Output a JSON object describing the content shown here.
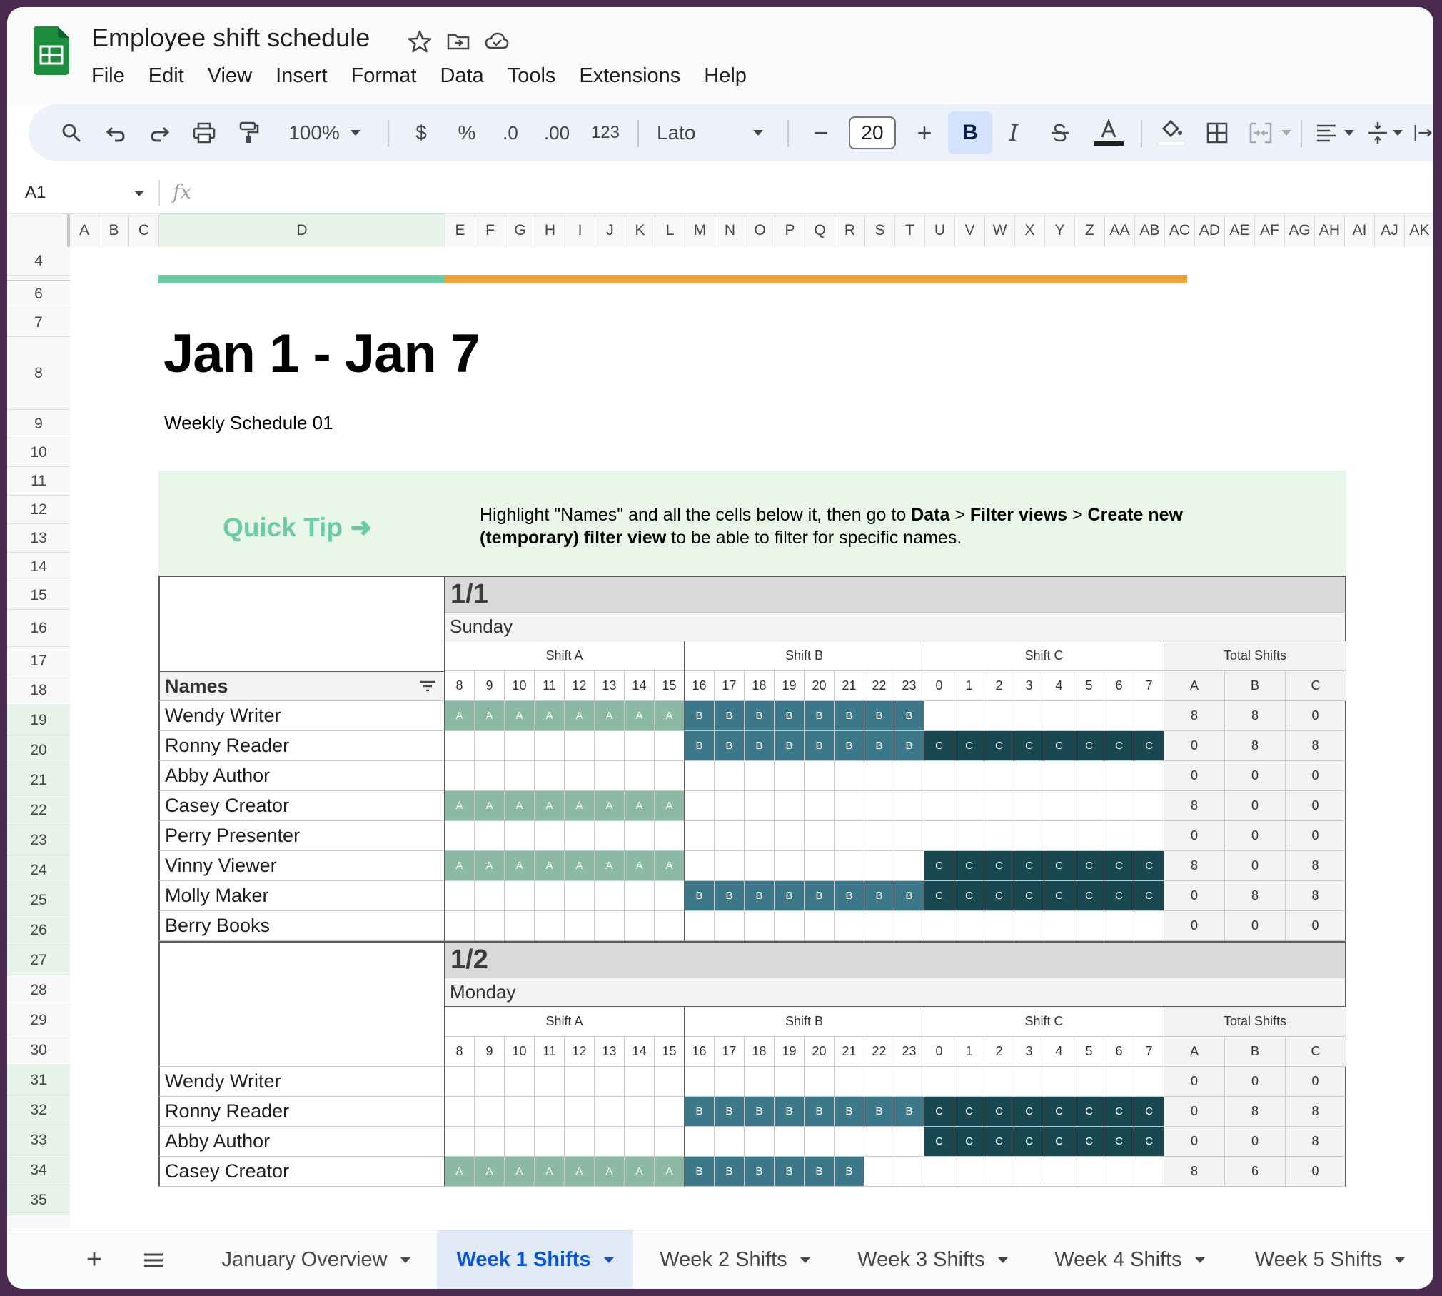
{
  "header": {
    "doc_title": "Employee shift schedule",
    "menu": [
      "File",
      "Edit",
      "View",
      "Insert",
      "Format",
      "Data",
      "Tools",
      "Extensions",
      "Help"
    ]
  },
  "toolbar": {
    "zoom": "100%",
    "currency": "$",
    "percent": "%",
    "dec_decrease": ".0",
    "dec_increase": ".00",
    "number_format": "123",
    "font": "Lato",
    "font_size": "20",
    "bold": "B",
    "italic": "I"
  },
  "formula_bar": {
    "cell_ref": "A1",
    "fx": "fx"
  },
  "columns": [
    "A",
    "B",
    "C",
    "D",
    "E",
    "F",
    "G",
    "H",
    "I",
    "J",
    "K",
    "L",
    "M",
    "N",
    "O",
    "P",
    "Q",
    "R",
    "S",
    "T",
    "U",
    "V",
    "W",
    "X",
    "Y",
    "Z",
    "AA",
    "AB",
    "AC",
    "AD",
    "AE",
    "AF",
    "AG",
    "AH",
    "AI",
    "AJ",
    "AK"
  ],
  "rows": [
    "4",
    "6",
    "7",
    "8",
    "9",
    "10",
    "11",
    "12",
    "13",
    "14",
    "15",
    "16",
    "17",
    "18",
    "19",
    "20",
    "21",
    "22",
    "23",
    "24",
    "25",
    "26",
    "27",
    "28",
    "29",
    "30",
    "31",
    "32",
    "33",
    "34",
    "35"
  ],
  "sheet": {
    "title": "Jan 1 - Jan 7",
    "subtitle": "Weekly Schedule 01",
    "tip_label": "Quick Tip ➜",
    "tip_parts": [
      {
        "t": "Highlight \"Names\" and all the cells below it, then go to ",
        "b": false
      },
      {
        "t": "Data",
        "b": true
      },
      {
        "t": " > ",
        "b": false
      },
      {
        "t": "Filter views",
        "b": true
      },
      {
        "t": " > ",
        "b": false
      },
      {
        "t": "Create new (temporary) filter view",
        "b": true
      },
      {
        "t": " to be able to filter for specific names.",
        "b": false
      }
    ],
    "names_header": "Names",
    "shift_labels": [
      "Shift A",
      "Shift B",
      "Shift C",
      "Total Shifts"
    ],
    "hours": [
      "8",
      "9",
      "10",
      "11",
      "12",
      "13",
      "14",
      "15",
      "16",
      "17",
      "18",
      "19",
      "20",
      "21",
      "22",
      "23",
      "0",
      "1",
      "2",
      "3",
      "4",
      "5",
      "6",
      "7"
    ],
    "total_cols": [
      "A",
      "B",
      "C"
    ],
    "days": [
      {
        "date": "1/1",
        "weekday": "Sunday",
        "show_names_header": true,
        "people": [
          {
            "name": "Wendy Writer",
            "a": 8,
            "b": 8,
            "c": 0,
            "ta": "8",
            "tb": "8",
            "tc": "0"
          },
          {
            "name": "Ronny Reader",
            "a": 0,
            "b": 8,
            "c": 8,
            "ta": "0",
            "tb": "8",
            "tc": "8"
          },
          {
            "name": "Abby Author",
            "a": 0,
            "b": 0,
            "c": 0,
            "ta": "0",
            "tb": "0",
            "tc": "0"
          },
          {
            "name": "Casey Creator",
            "a": 8,
            "b": 0,
            "c": 0,
            "ta": "8",
            "tb": "0",
            "tc": "0"
          },
          {
            "name": "Perry Presenter",
            "a": 0,
            "b": 0,
            "c": 0,
            "ta": "0",
            "tb": "0",
            "tc": "0"
          },
          {
            "name": "Vinny Viewer",
            "a": 8,
            "b": 0,
            "c": 8,
            "ta": "8",
            "tb": "0",
            "tc": "8"
          },
          {
            "name": "Molly Maker",
            "a": 0,
            "b": 8,
            "c": 8,
            "ta": "0",
            "tb": "8",
            "tc": "8"
          },
          {
            "name": "Berry Books",
            "a": 0,
            "b": 0,
            "c": 0,
            "ta": "0",
            "tb": "0",
            "tc": "0"
          }
        ]
      },
      {
        "date": "1/2",
        "weekday": "Monday",
        "show_names_header": false,
        "people": [
          {
            "name": "Wendy Writer",
            "a": 0,
            "b": 0,
            "c": 0,
            "ta": "0",
            "tb": "0",
            "tc": "0"
          },
          {
            "name": "Ronny Reader",
            "a": 0,
            "b": 8,
            "c": 8,
            "ta": "0",
            "tb": "8",
            "tc": "8"
          },
          {
            "name": "Abby Author",
            "a": 0,
            "b": 0,
            "c": 8,
            "ta": "0",
            "tb": "0",
            "tc": "8"
          },
          {
            "name": "Casey Creator",
            "a": 8,
            "b": 6,
            "c": 0,
            "ta": "8",
            "tb": "6",
            "tc": "0"
          }
        ]
      }
    ]
  },
  "tabs": [
    "January Overview",
    "Week 1 Shifts",
    "Week 2 Shifts",
    "Week 3 Shifts",
    "Week 4 Shifts",
    "Week 5 Shifts"
  ],
  "active_tab": 1,
  "colors": {
    "shiftA": "#8cb8a6",
    "shiftB": "#3c7889",
    "shiftC": "#1a4850",
    "accent_green": "#6fcaa8",
    "accent_orange": "#f0a23e"
  }
}
